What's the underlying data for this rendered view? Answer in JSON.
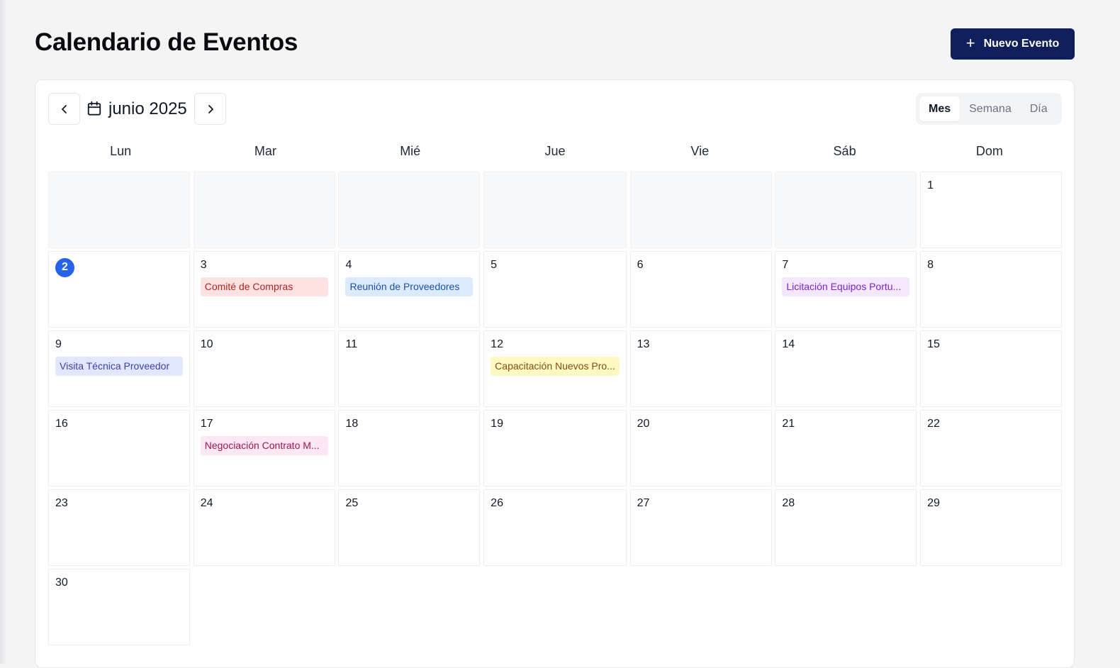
{
  "page": {
    "title": "Calendario de Eventos",
    "new_event_label": "Nuevo Evento"
  },
  "calendar": {
    "month_label": "junio 2025",
    "views": [
      {
        "label": "Mes",
        "active": true
      },
      {
        "label": "Semana",
        "active": false
      },
      {
        "label": "Día",
        "active": false
      }
    ],
    "weekdays": [
      "Lun",
      "Mar",
      "Mié",
      "Jue",
      "Vie",
      "Sáb",
      "Dom"
    ],
    "leading_empty_days": 6,
    "days_in_month": 30,
    "today": 2,
    "events": [
      {
        "day": 3,
        "title": "Comité de Compras",
        "bg": "#fee2e2",
        "fg": "#b42323"
      },
      {
        "day": 4,
        "title": "Reunión de Proveedores",
        "bg": "#dbeafe",
        "fg": "#1e4fa8"
      },
      {
        "day": 7,
        "title": "Licitación Equipos Portu...",
        "bg": "#f3e8ff",
        "fg": "#7e22ce"
      },
      {
        "day": 9,
        "title": "Visita Técnica Proveedor",
        "bg": "#e0e7ff",
        "fg": "#3f3fa8"
      },
      {
        "day": 12,
        "title": "Capacitación Nuevos Pro...",
        "bg": "#fef9c3",
        "fg": "#854d0e"
      },
      {
        "day": 17,
        "title": "Negociación Contrato M...",
        "bg": "#fce7f3",
        "fg": "#9d174d"
      }
    ]
  },
  "icons": {
    "prev": "chevron-left-icon",
    "next": "chevron-right-icon",
    "calendar": "calendar-icon",
    "add": "plus-icon"
  }
}
